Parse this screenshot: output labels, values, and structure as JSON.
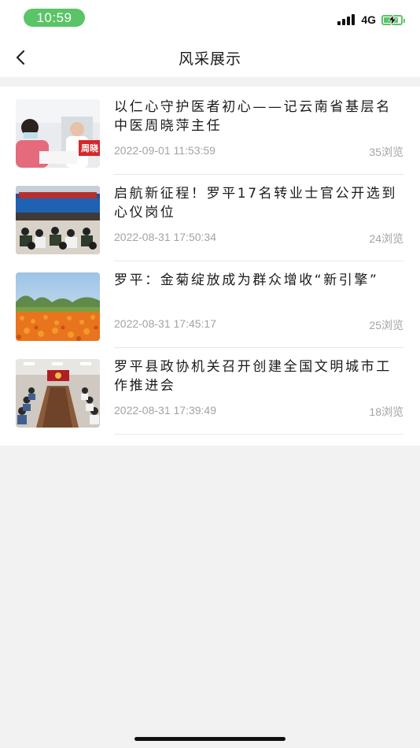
{
  "status_bar": {
    "time": "10:59",
    "network": "4G",
    "battery_level": 0.85,
    "colors": {
      "accent": "#5ac467"
    }
  },
  "nav": {
    "title": "风采展示",
    "back_icon": "chevron-left-icon"
  },
  "articles": [
    {
      "title": "以仁心守护医者初心——记云南省基层名中医周晓萍主任",
      "date": "2022-09-01 11:53:59",
      "views": "35浏览",
      "thumb_banner_text": "周晓"
    },
    {
      "title": "启航新征程！罗平17名转业士官公开选到心仪岗位",
      "date": "2022-08-31 17:50:34",
      "views": "24浏览"
    },
    {
      "title": "罗平：金菊绽放成为群众增收“新引擎”",
      "date": "2022-08-31 17:45:17",
      "views": "25浏览"
    },
    {
      "title": "罗平县政协机关召开创建全国文明城市工作推进会",
      "date": "2022-08-31 17:39:49",
      "views": "18浏览"
    }
  ]
}
